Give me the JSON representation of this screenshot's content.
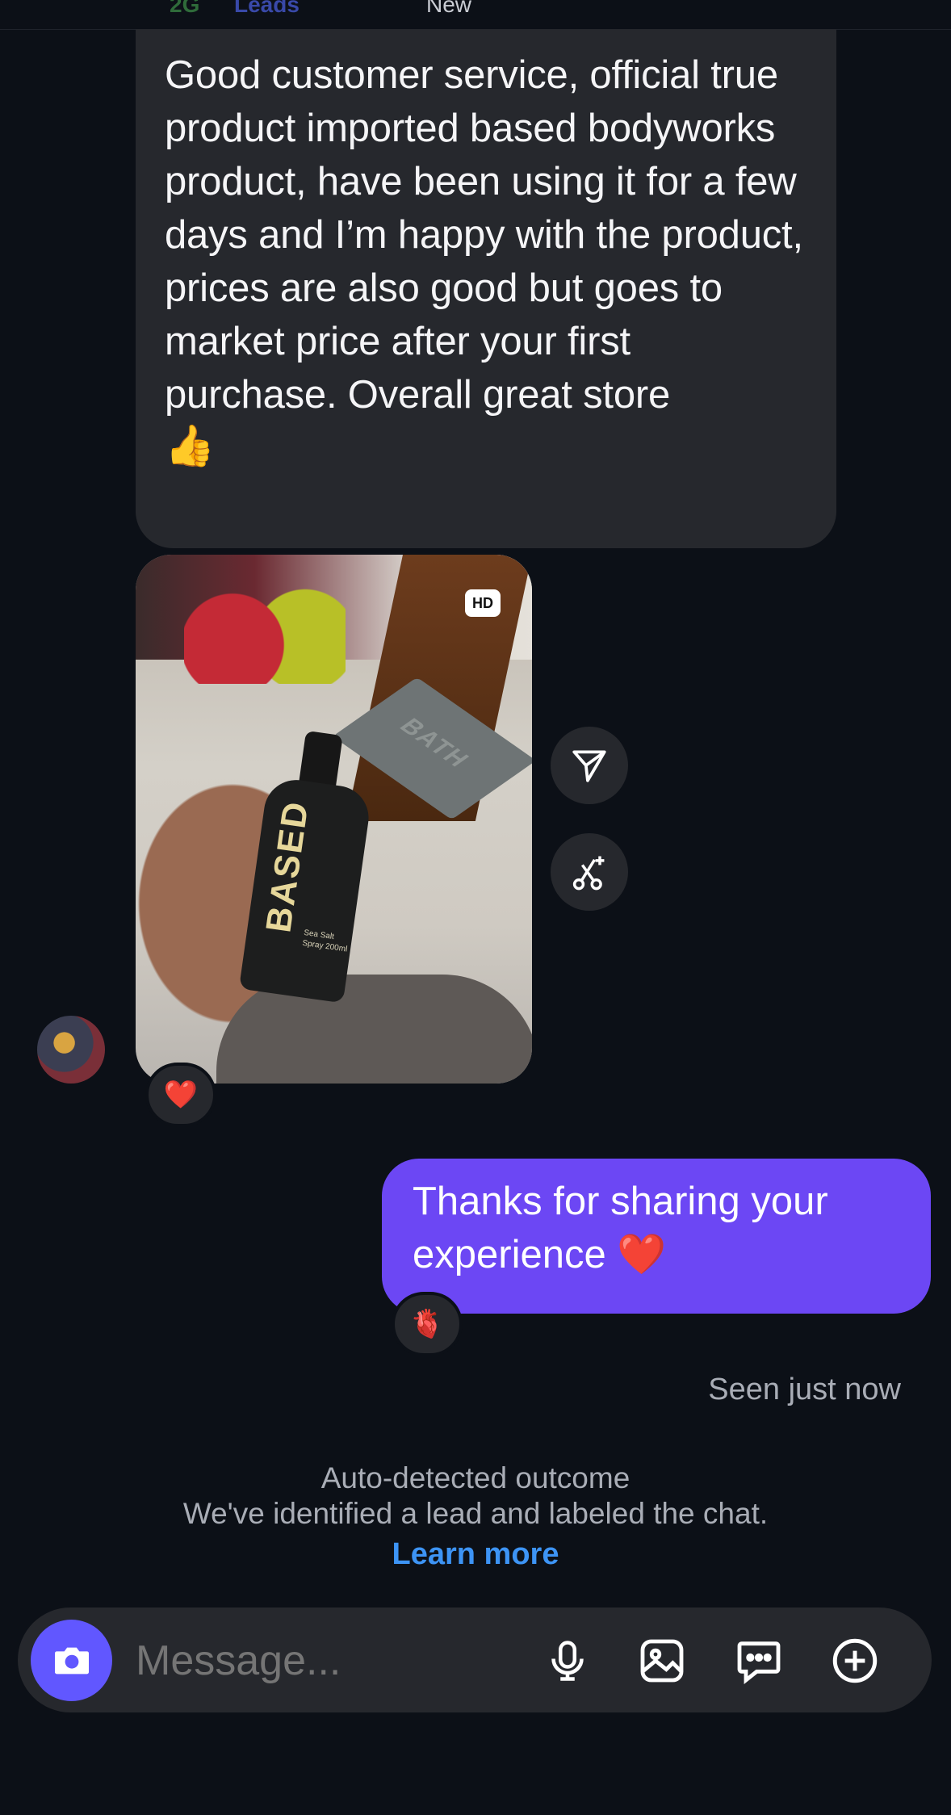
{
  "top_partial": {
    "left": "2G",
    "mid": "Leads",
    "right": "New"
  },
  "incoming_message": {
    "text": "Good customer service, official true product imported based bodyworks product, have been using it for a few days and I’m happy with the product, prices are also good but goes to market price after your first purchase. Overall great store",
    "emoji": "👍"
  },
  "photo": {
    "hd_badge": "HD",
    "bottle_brand": "BASED",
    "bottle_text": "Sea Salt Spray 200ml",
    "mat_text": "BATH"
  },
  "incoming_reaction": "❤️",
  "outgoing_message": {
    "text": "Thanks for sharing your experience ❤️"
  },
  "outgoing_reaction": "🫀",
  "status": {
    "seen": "Seen just now"
  },
  "notice": {
    "title": "Auto-detected outcome",
    "body": "We've identified a lead and labeled the chat.",
    "link": "Learn more"
  },
  "composer": {
    "placeholder": "Message..."
  },
  "colors": {
    "background": "#0c1017",
    "incoming_bubble": "#26282d",
    "outgoing_bubble": "#6c47f4",
    "link": "#3d94f5"
  }
}
